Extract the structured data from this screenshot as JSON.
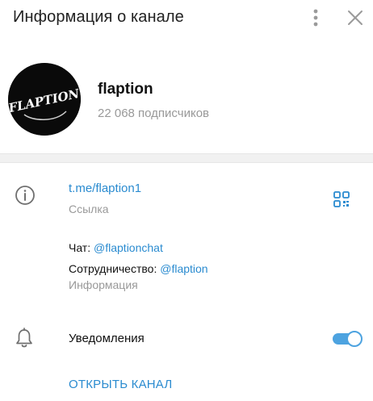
{
  "header": {
    "title": "Информация о канале",
    "more_icon": "vertical-dots-icon",
    "close_icon": "close-icon"
  },
  "profile": {
    "avatar_text": "FLAPTION",
    "name": "flaption",
    "subscribers": "22 068 подписчиков"
  },
  "info": {
    "link_value": "t.me/flaption1",
    "link_label": "Ссылка",
    "chat_prefix": "Чат: ",
    "chat_mention": "@flaptionchat",
    "coop_prefix": "Сотрудничество: ",
    "coop_mention": "@flaption",
    "description_label": "Информация"
  },
  "notifications": {
    "label": "Уведомления",
    "enabled": true
  },
  "actions": {
    "open_channel": "ОТКРЫТЬ КАНАЛ"
  },
  "colors": {
    "accent": "#2a8bd0",
    "toggle": "#4da3e0",
    "muted": "#999999",
    "avatar_bg": "#0a0a0a"
  }
}
